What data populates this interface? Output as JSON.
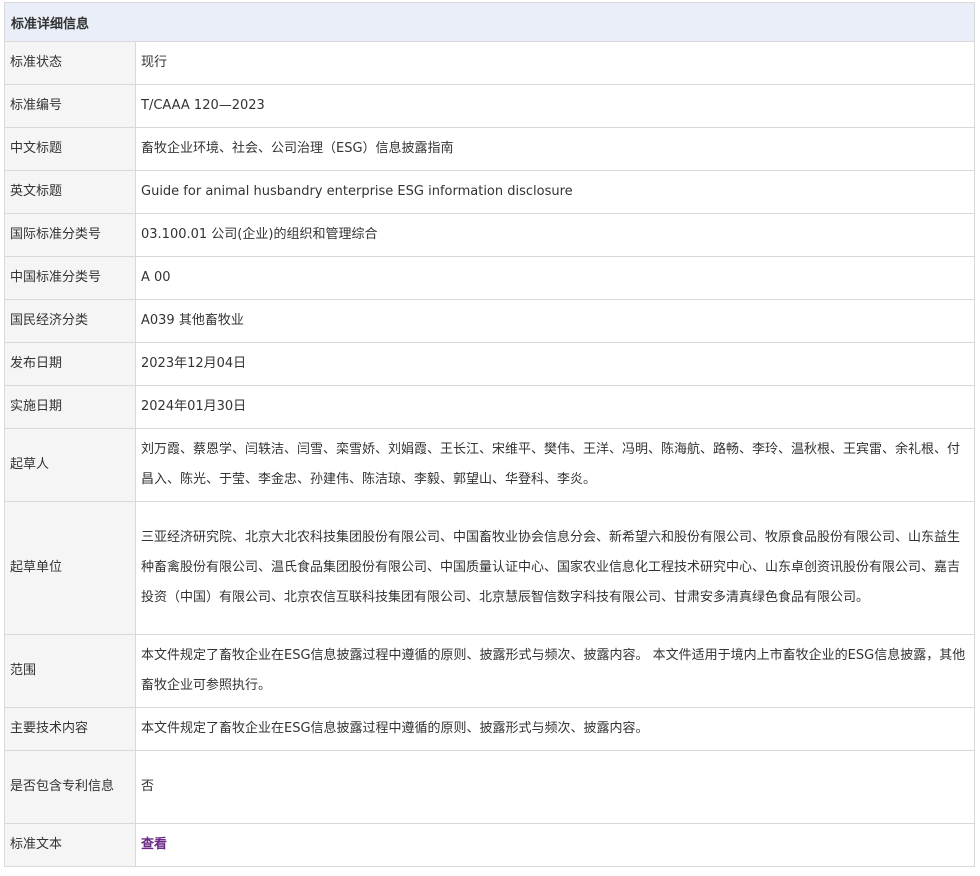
{
  "header": {
    "title": "标准详细信息"
  },
  "rows": [
    {
      "label": "标准状态",
      "value": "现行"
    },
    {
      "label": "标准编号",
      "value": "T/CAAA 120—2023"
    },
    {
      "label": "中文标题",
      "value": "畜牧企业环境、社会、公司治理（ESG）信息披露指南"
    },
    {
      "label": "英文标题",
      "value": "Guide for animal husbandry enterprise ESG information disclosure"
    },
    {
      "label": "国际标准分类号",
      "value": "03.100.01 公司(企业)的组织和管理综合"
    },
    {
      "label": "中国标准分类号",
      "value": "A 00"
    },
    {
      "label": "国民经济分类",
      "value": "A039 其他畜牧业"
    },
    {
      "label": "发布日期",
      "value": "2023年12月04日"
    },
    {
      "label": "实施日期",
      "value": "2024年01月30日"
    },
    {
      "label": "起草人",
      "value": "刘万霞、蔡恩学、闫轶洁、闫雪、栾雪娇、刘娟霞、王长江、宋维平、樊伟、王洋、冯明、陈海航、路畅、李玲、温秋根、王宾雷、余礼根、付昌入、陈光、于莹、李金忠、孙建伟、陈洁琼、李毅、郭望山、华登科、李炎。"
    },
    {
      "label": "起草单位",
      "value": "三亚经济研究院、北京大北农科技集团股份有限公司、中国畜牧业协会信息分会、新希望六和股份有限公司、牧原食品股份有限公司、山东益生种畜禽股份有限公司、温氏食品集团股份有限公司、中国质量认证中心、国家农业信息化工程技术研究中心、山东卓创资讯股份有限公司、嘉吉投资（中国）有限公司、北京农信互联科技集团有限公司、北京慧辰智信数字科技有限公司、甘肃安多清真绿色食品有限公司。"
    },
    {
      "label": "范围",
      "value": "本文件规定了畜牧企业在ESG信息披露过程中遵循的原则、披露形式与频次、披露内容。 本文件适用于境内上市畜牧企业的ESG信息披露，其他畜牧企业可参照执行。"
    },
    {
      "label": "主要技术内容",
      "value": "本文件规定了畜牧企业在ESG信息披露过程中遵循的原则、披露形式与频次、披露内容。"
    },
    {
      "label": "是否包含专利信息",
      "value": "否"
    },
    {
      "label": "标准文本",
      "value": "查看"
    }
  ],
  "colors": {
    "header_bg": "#e9eef8",
    "label_bg": "#f5f5f5",
    "border": "#d9d9d9",
    "link": "#6b2a87"
  }
}
